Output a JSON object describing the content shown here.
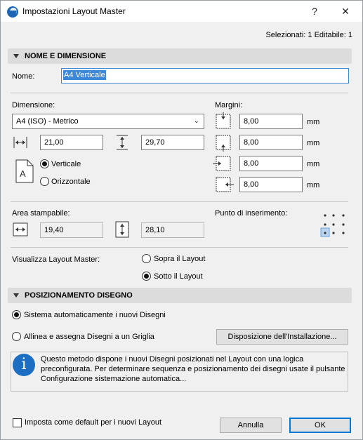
{
  "window": {
    "title": "Impostazioni Layout Master",
    "help_label": "?",
    "close_label": "✕"
  },
  "selection_info": "Selezionati: 1 Editabile: 1",
  "section1": {
    "label": "NOME E DIMENSIONE"
  },
  "name": {
    "label": "Nome:",
    "value": "A4 Verticale"
  },
  "dimension": {
    "label": "Dimensione:",
    "preset": "A4 (ISO) - Metrico",
    "width": "21,00",
    "height": "29,70",
    "orientation_vertical": "Verticale",
    "orientation_horizontal": "Orizzontale",
    "selected_orientation": "vertical"
  },
  "margins": {
    "label": "Margini:",
    "top": "8,00",
    "bottom": "8,00",
    "left": "8,00",
    "right": "8,00",
    "unit": "mm"
  },
  "printable": {
    "label": "Area stampabile:",
    "width": "19,40",
    "height": "28,10"
  },
  "insertion_point": {
    "label": "Punto di inserimento:",
    "selected": "bottom-left"
  },
  "display": {
    "label": "Visualizza Layout Master:",
    "above": "Sopra il Layout",
    "below": "Sotto il Layout",
    "selected": "below"
  },
  "section2": {
    "label": "POSIZIONAMENTO DISEGNO"
  },
  "placement": {
    "auto_label": "Sistema automaticamente i nuovi Disegni",
    "grid_label": "Allinea e assegna Disegni a un Griglia",
    "selected": "auto",
    "install_button": "Disposizione dell'Installazione..."
  },
  "info": {
    "text": "Questo metodo dispone i nuovi Disegni posizionati nel Layout con una logica preconfigurata. Per determinare sequenza e posizionamento dei disegni usate il pulsante Configurazione sistemazione automatica..."
  },
  "footer": {
    "default_checkbox_label": "Imposta come default per i nuovi Layout",
    "cancel_label": "Annulla",
    "ok_label": "OK"
  }
}
